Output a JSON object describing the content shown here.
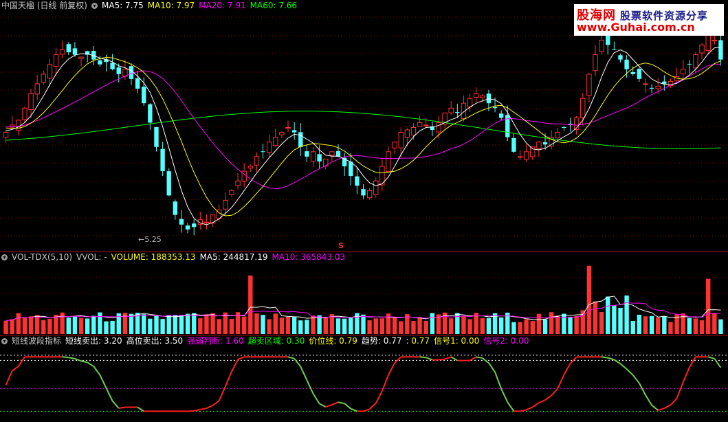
{
  "main_panel": {
    "header_items": [
      {
        "text": "中国天楹 (日线 前复权)",
        "color": "#c8c8c8"
      },
      {
        "text": "MA5: 7.75",
        "color": "#ffffff"
      },
      {
        "text": "MA10: 7.97",
        "color": "#ffff00"
      },
      {
        "text": "MA20: 7.91",
        "color": "#ff00ff"
      },
      {
        "text": "MA60: 7.66",
        "color": "#00ff00"
      }
    ],
    "low_label": "←5.25",
    "marker_s": "S"
  },
  "volume_panel": {
    "header_items": [
      {
        "text": "VOL-TDX(5,10)",
        "color": "#c8c8c8"
      },
      {
        "text": "VVOL: -",
        "color": "#c8c8c8"
      },
      {
        "text": "VOLUME: 188353.13",
        "color": "#ffff00"
      },
      {
        "text": "MA5: 244817.19",
        "color": "#ffffff"
      },
      {
        "text": "MA10: 365843.03",
        "color": "#ff00ff"
      }
    ]
  },
  "indicator_panel": {
    "header_items": [
      {
        "text": "短线波段指标",
        "color": "#c8c8c8"
      },
      {
        "text": "短线卖出: 3.20",
        "color": "#ffffff"
      },
      {
        "text": "高位卖出: 3.50",
        "color": "#ffffff"
      },
      {
        "text": "强弱判断: 1.60",
        "color": "#ff00ff"
      },
      {
        "text": "超卖区域: 0.30",
        "color": "#00ff00"
      },
      {
        "text": "价位线: 0.79",
        "color": "#ffff00"
      },
      {
        "text": "趋势: 0.77",
        "color": "#ffffff"
      },
      {
        "text": ": 0.77",
        "color": "#ffff00"
      },
      {
        "text": "信号1: 0.00",
        "color": "#ffff00"
      },
      {
        "text": "信号2: 0.00",
        "color": "#ff00ff"
      }
    ]
  },
  "watermark": {
    "logo_text": "股海网",
    "slogan": "股票软件资源分享",
    "url": "www.Guhai.com.cn"
  },
  "colors": {
    "up": "#ff3232",
    "down": "#54ffff",
    "ma5": "#ffffff",
    "ma10": "#ffff00",
    "ma20": "#ff00ff",
    "ma60": "#00ff00",
    "grid": "#8b0000",
    "divider": "#b00000"
  },
  "chart_data": {
    "type": "candlestick",
    "price_range": [
      5.0,
      9.8
    ],
    "annotations": [
      {
        "label": "←5.25",
        "value": 5.25
      }
    ],
    "closes": [
      7.3,
      7.45,
      7.55,
      7.8,
      8.1,
      8.3,
      8.5,
      8.7,
      8.9,
      9.0,
      8.95,
      8.9,
      8.85,
      8.9,
      8.8,
      8.7,
      8.75,
      8.6,
      8.5,
      8.6,
      8.4,
      8.2,
      7.9,
      7.5,
      7.0,
      6.5,
      6.0,
      5.6,
      5.4,
      5.3,
      5.35,
      5.5,
      5.45,
      5.6,
      5.7,
      5.9,
      6.1,
      6.3,
      6.5,
      6.6,
      6.8,
      6.9,
      7.1,
      7.2,
      7.3,
      7.4,
      7.3,
      7.0,
      6.8,
      6.9,
      6.7,
      6.75,
      6.9,
      6.8,
      6.6,
      6.4,
      6.2,
      6.0,
      6.1,
      6.3,
      6.6,
      6.9,
      7.1,
      7.3,
      7.35,
      7.4,
      7.5,
      7.45,
      7.35,
      7.5,
      7.7,
      7.8,
      7.7,
      7.9,
      8.0,
      8.1,
      8.05,
      7.9,
      7.8,
      7.6,
      7.2,
      6.9,
      6.8,
      6.9,
      7.0,
      7.1,
      7.05,
      7.2,
      7.3,
      7.4,
      7.45,
      7.6,
      8.0,
      8.5,
      8.9,
      9.2,
      9.1,
      9.0,
      8.8,
      8.6,
      8.5,
      8.4,
      8.3,
      8.2,
      8.25,
      8.3,
      8.35,
      8.45,
      8.6,
      8.7,
      8.9,
      9.1,
      9.3,
      9.2,
      8.8
    ],
    "volume_range": [
      0,
      1100000
    ],
    "indicator_range": [
      0,
      4
    ],
    "indicator_levels": [
      3.5,
      3.2,
      1.6,
      0.3
    ]
  }
}
